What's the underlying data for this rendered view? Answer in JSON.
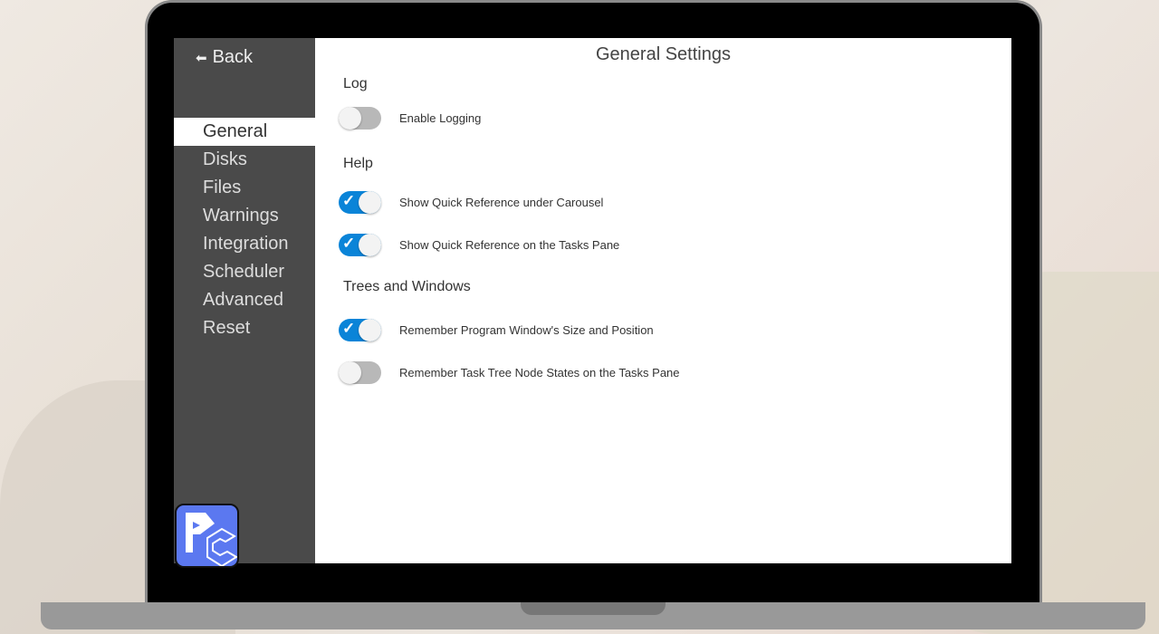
{
  "sidebar": {
    "back_label": "Back",
    "items": [
      "General",
      "Disks",
      "Files",
      "Warnings",
      "Integration",
      "Scheduler",
      "Advanced",
      "Reset"
    ],
    "active": "General"
  },
  "main": {
    "title": "General Settings",
    "sections": [
      {
        "title": "Log",
        "options": [
          {
            "label": "Enable Logging",
            "on": false
          }
        ]
      },
      {
        "title": "Help",
        "options": [
          {
            "label": "Show Quick Reference under Carousel",
            "on": true
          },
          {
            "label": "Show Quick Reference on the Tasks Pane",
            "on": true
          }
        ]
      },
      {
        "title": "Trees and Windows",
        "options": [
          {
            "label": "Remember Program Window's Size and Position",
            "on": true
          },
          {
            "label": "Remember Task Tree Node States on the Tasks Pane",
            "on": false
          }
        ]
      }
    ]
  },
  "colors": {
    "accent": "#0a84d8",
    "sidebar": "#4a4a4a",
    "logo": "#5b78f0"
  }
}
